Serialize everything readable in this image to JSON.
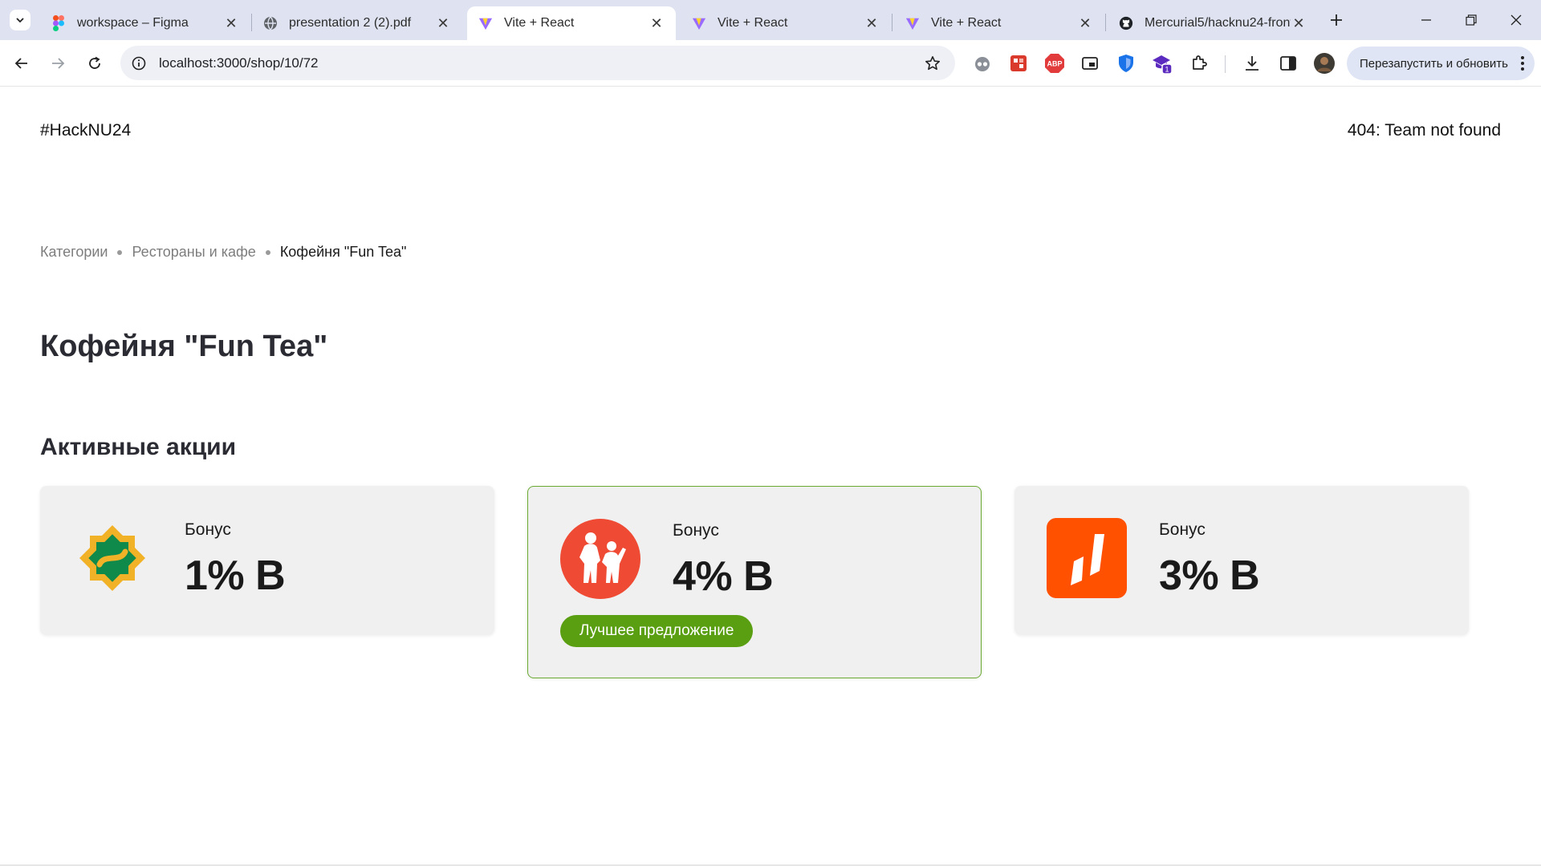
{
  "browser": {
    "tabs": [
      {
        "title": "workspace – Figma",
        "icon": "figma-icon"
      },
      {
        "title": "presentation 2 (2).pdf",
        "icon": "globe-icon"
      },
      {
        "title": "Vite + React",
        "icon": "vite-icon",
        "active": true
      },
      {
        "title": "Vite + React",
        "icon": "vite-icon"
      },
      {
        "title": "Vite + React",
        "icon": "vite-icon"
      },
      {
        "title": "Mercurial5/hacknu24-front",
        "icon": "github-icon"
      }
    ],
    "url": "localhost:3000/shop/10/72",
    "relaunch_label": "Перезапустить и обновить",
    "extension_badge": "1",
    "extension_abp": "ABP"
  },
  "header": {
    "brand": "#HackNU24",
    "team": "404: Team not found"
  },
  "breadcrumb": [
    "Категории",
    "Рестораны и кафе",
    "Кофейня \"Fun Tea\""
  ],
  "page": {
    "title": "Кофейня \"Fun Tea\"",
    "section_title": "Активные акции"
  },
  "promotions": [
    {
      "type": "Бонус",
      "value": "1% B",
      "logo": "green-star-bank-logo",
      "best": false
    },
    {
      "type": "Бонус",
      "value": "4% B",
      "logo": "red-family-bank-logo",
      "best": true,
      "badge": "Лучшее предложение"
    },
    {
      "type": "Бонус",
      "value": "3% B",
      "logo": "orange-bank-logo",
      "best": false
    }
  ],
  "colors": {
    "best_border": "#6aaa33",
    "badge_bg": "#5a9e12",
    "card_bg": "#f0f0f0"
  }
}
